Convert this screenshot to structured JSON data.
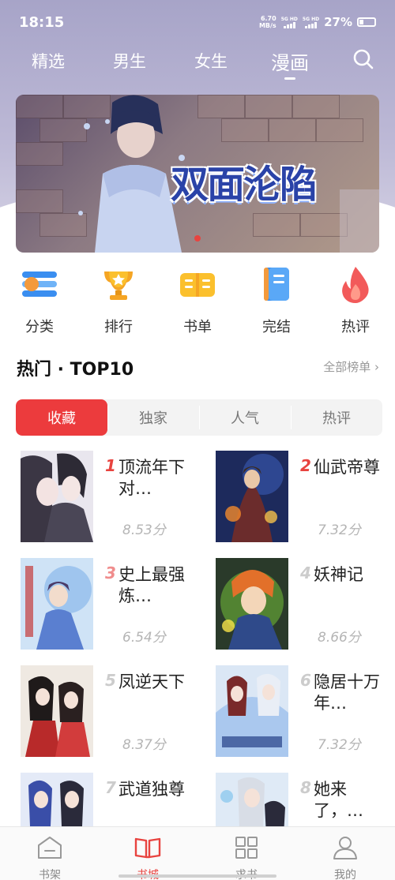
{
  "status_bar": {
    "time": "18:15",
    "net_speed_value": "6.70",
    "net_speed_unit": "MB/s",
    "signal_1_label": "5G HD",
    "signal_2_label": "5G HD",
    "battery": "27%",
    "battery_level": 0.27
  },
  "top_nav": {
    "tabs": [
      {
        "label": "精选"
      },
      {
        "label": "男生"
      },
      {
        "label": "女生"
      },
      {
        "label": "漫画",
        "active": true
      }
    ],
    "search_icon": "search-icon"
  },
  "banner": {
    "title": "双面沦陷"
  },
  "categories": [
    {
      "label": "分类",
      "icon": "category-icon"
    },
    {
      "label": "排行",
      "icon": "trophy-icon"
    },
    {
      "label": "书单",
      "icon": "booklist-icon"
    },
    {
      "label": "完结",
      "icon": "finished-book-icon"
    },
    {
      "label": "热评",
      "icon": "flame-icon"
    }
  ],
  "section": {
    "title": "热门 · TOP10",
    "more": "全部榜单 ›"
  },
  "segments": [
    {
      "label": "收藏",
      "active": true
    },
    {
      "label": "独家"
    },
    {
      "label": "人气"
    },
    {
      "label": "热评"
    }
  ],
  "ranking": [
    {
      "rank": "1",
      "name": "顶流年下对…",
      "score": "8.53分"
    },
    {
      "rank": "2",
      "name": "仙武帝尊",
      "score": "7.32分"
    },
    {
      "rank": "3",
      "name": "史上最强炼…",
      "score": "6.54分"
    },
    {
      "rank": "4",
      "name": "妖神记",
      "score": "8.66分"
    },
    {
      "rank": "5",
      "name": "凤逆天下",
      "score": "8.37分"
    },
    {
      "rank": "6",
      "name": "隐居十万年…",
      "score": "7.32分"
    },
    {
      "rank": "7",
      "name": "武道独尊",
      "score": ""
    },
    {
      "rank": "8",
      "name": "她来了，…",
      "score": ""
    }
  ],
  "colors": {
    "accent": "#e8433f",
    "rank_top_color": "#e8433f",
    "rank_mid_color": "#f08d8d",
    "rank_low_color": "#cccccc"
  },
  "bottom_nav": [
    {
      "label": "书架",
      "icon": "bookshelf-icon"
    },
    {
      "label": "书城",
      "icon": "bookstore-icon",
      "active": true
    },
    {
      "label": "求书",
      "icon": "grid-icon"
    },
    {
      "label": "我的",
      "icon": "profile-icon"
    }
  ]
}
